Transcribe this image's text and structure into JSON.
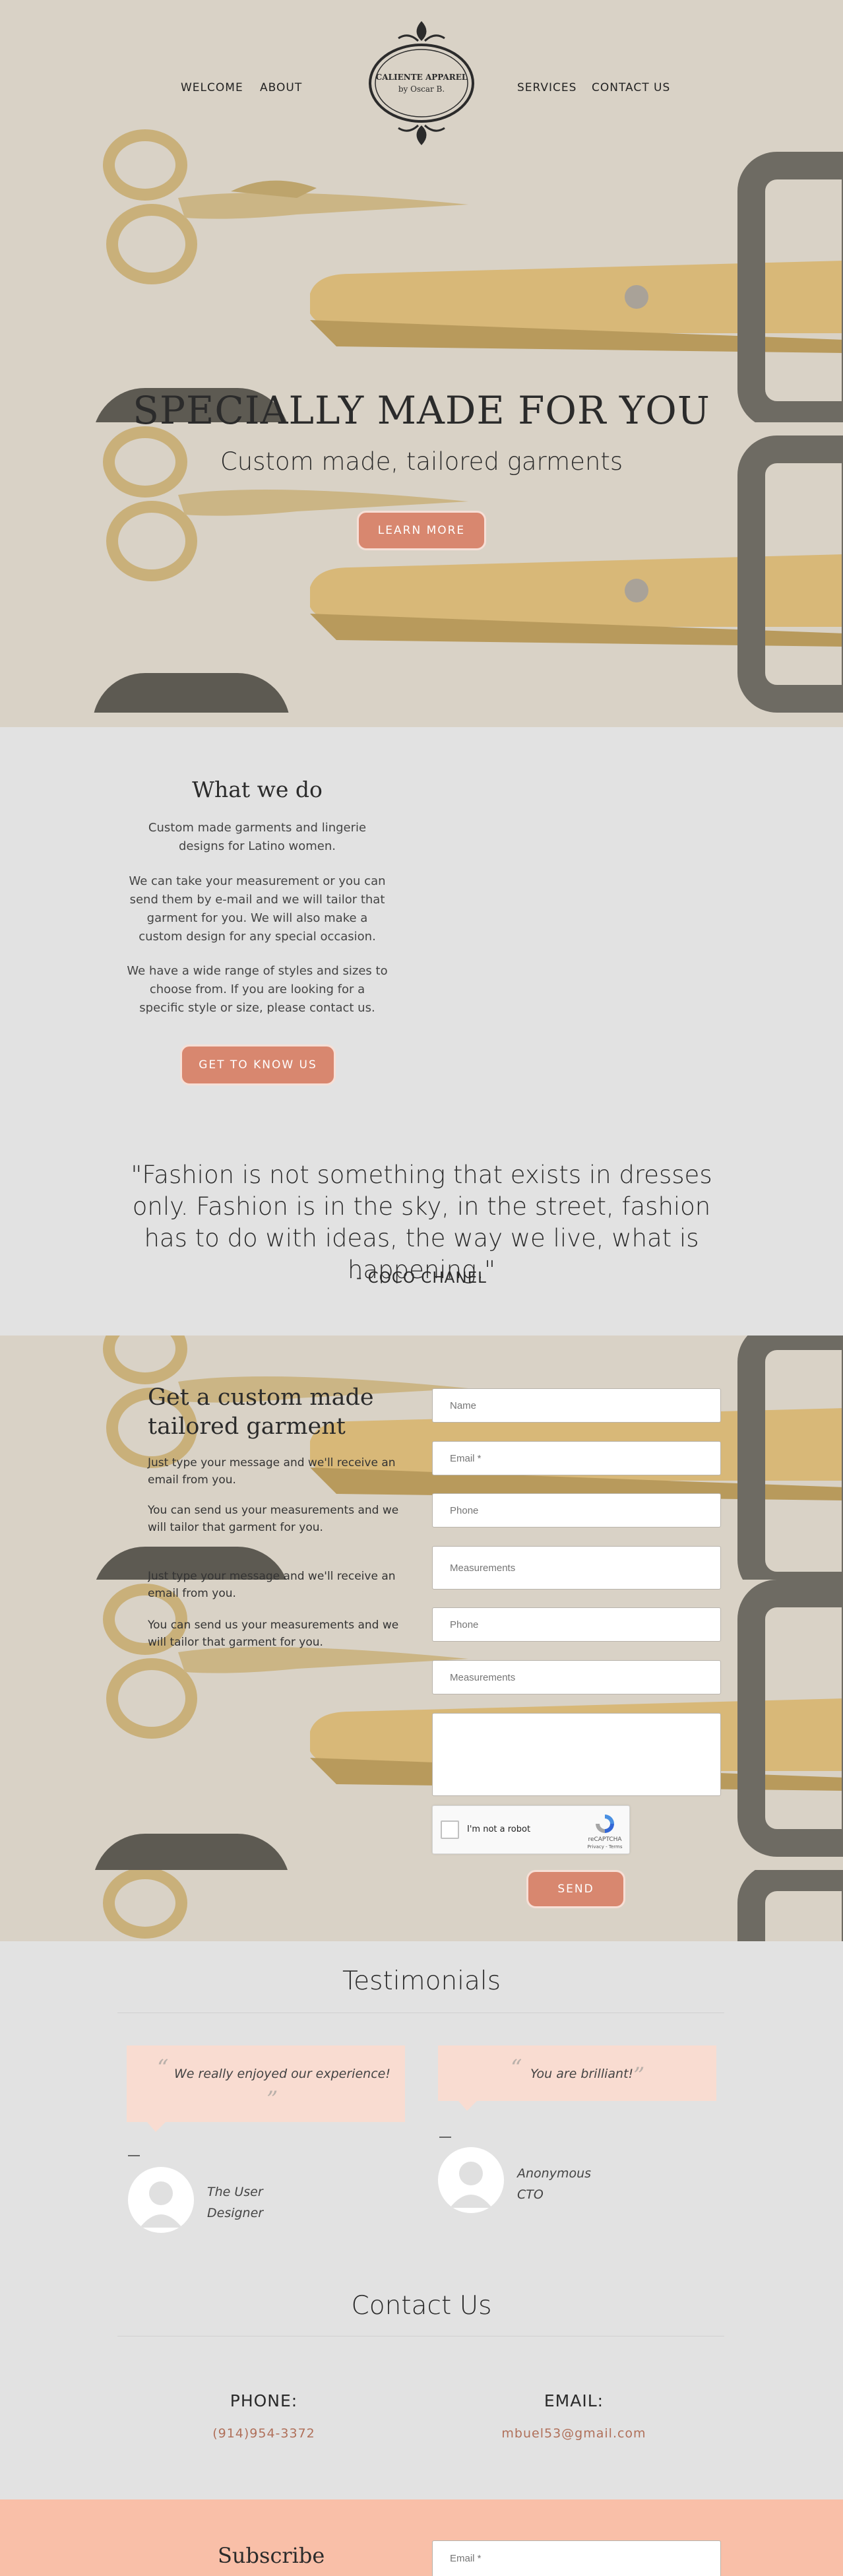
{
  "nav": {
    "left": [
      "WELCOME",
      "ABOUT"
    ],
    "right": [
      "SERVICES",
      "CONTACT US"
    ],
    "logo_line1": "CALIENTE APPAREL",
    "logo_line2": "by Oscar B."
  },
  "hero": {
    "title": "SPECIALLY MADE FOR YOU",
    "subtitle": "Custom made, tailored garments",
    "button": "LEARN MORE"
  },
  "what_we_do": {
    "title": "What we do",
    "p1": "Custom made garments and lingerie designs for Latino women.",
    "p2": "We can take your measurement or you can send them by e-mail and we will tailor that garment for you.  We will also make a custom design for any special occasion.",
    "p3": "We have a wide range of styles and sizes to choose from. If you are looking for a specific style or size, please contact us.",
    "button": "GET TO KNOW US"
  },
  "quote": {
    "text": "\"Fashion is not something that exists in dresses only. Fashion is in the sky, in the street, fashion has to do with ideas, the way we live, what is happening.\"",
    "author": "- COCO CHANEL"
  },
  "form": {
    "title": "Get a custom made tailored garment",
    "p1": "Just type your message and we'll receive an email from you.",
    "p2": "You can send us your measurements and we will tailor that garment for you.",
    "p1_overlap": "Just type your message and we'll receive an email from you.",
    "p2_overlap": "You can send us your measurements and we will tailor that garment for you.",
    "placeholders": {
      "name": "Name",
      "email": "Email *",
      "phone": "Phone",
      "measurements": "Measurements",
      "phone2": "Phone",
      "measurements2": "Measurements"
    },
    "captcha_label": "I'm not a robot",
    "captcha_brand": "reCAPTCHA",
    "captcha_links": "Privacy - Terms",
    "send": "SEND"
  },
  "testimonials": {
    "title": "Testimonials",
    "items": [
      {
        "quote": "We really enjoyed our experience!",
        "name": "The User",
        "role": "Designer"
      },
      {
        "quote": "You are brilliant!",
        "name": "Anonymous",
        "role": "CTO"
      }
    ]
  },
  "contact": {
    "title": "Contact Us",
    "phone_label": "PHONE:",
    "phone": "(914)954-3372",
    "email_label": "EMAIL:",
    "email": "mbuel53@gmail.com"
  },
  "subscribe": {
    "title": "Subscribe",
    "placeholder": "Email *"
  },
  "colors": {
    "accent": "#d8876f",
    "beige": "#d9d2c6",
    "subscribe_bg": "#f9bfa8",
    "bubble": "#f9dcd1"
  }
}
